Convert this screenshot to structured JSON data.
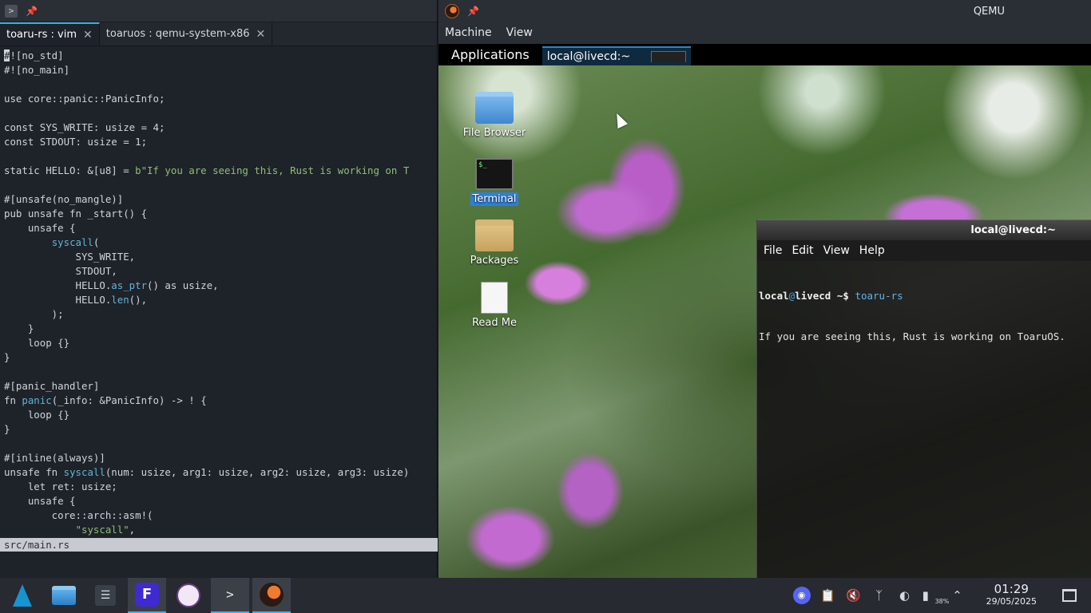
{
  "konsole": {
    "tabs": [
      {
        "label": "toaru-rs : vim",
        "active": true
      },
      {
        "label": "toaruos : qemu-system-x86",
        "active": false
      }
    ],
    "code_lines": [
      "#![no_std]",
      "#![no_main]",
      "",
      "use core::panic::PanicInfo;",
      "",
      "const SYS_WRITE: usize = 4;",
      "const STDOUT: usize = 1;",
      "",
      "static HELLO: &[u8] = b\"If you are seeing this, Rust is working on T",
      "",
      "#[unsafe(no_mangle)]",
      "pub unsafe fn _start() {",
      "    unsafe {",
      "        syscall(",
      "            SYS_WRITE,",
      "            STDOUT,",
      "            HELLO.as_ptr() as usize,",
      "            HELLO.len(),",
      "        );",
      "    }",
      "    loop {}",
      "}",
      "",
      "#[panic_handler]",
      "fn panic(_info: &PanicInfo) -> ! {",
      "    loop {}",
      "}",
      "",
      "#[inline(always)]",
      "unsafe fn syscall(num: usize, arg1: usize, arg2: usize, arg3: usize)",
      "    let ret: usize;",
      "    unsafe {",
      "        core::arch::asm!(",
      "            \"syscall\","
    ],
    "status_file": "src/main.rs"
  },
  "qemu": {
    "title": "QEMU",
    "menu": [
      "Machine",
      "View"
    ],
    "guest": {
      "panel": {
        "applications": "Applications",
        "task_label": "local@livecd:~"
      },
      "desktop_icons": [
        {
          "label": "File Browser",
          "icon": "folder-icon",
          "selected": false
        },
        {
          "label": "Terminal",
          "icon": "terminal-icon",
          "selected": true
        },
        {
          "label": "Packages",
          "icon": "package-icon",
          "selected": false
        },
        {
          "label": "Read Me",
          "icon": "document-icon",
          "selected": false
        }
      ],
      "terminal": {
        "title": "local@livecd:~",
        "menu": [
          "File",
          "Edit",
          "View",
          "Help"
        ],
        "prompt_user": "local",
        "prompt_at": "@",
        "prompt_host": "livecd",
        "prompt_path": " ~$ ",
        "command": "toaru-rs",
        "output": "If you are seeing this, Rust is working on ToaruOS."
      }
    }
  },
  "taskbar": {
    "apps": [
      "arch-launcher-icon",
      "file-manager-icon",
      "system-settings-icon",
      "fusion-icon",
      "rust-app-icon",
      "konsole-icon",
      "qemu-icon"
    ],
    "tray": {
      "battery_percent": "38%",
      "time": "01:29",
      "date": "29/05/2025"
    },
    "colors": {
      "accent": "#3daee9",
      "panel": "#272a31"
    }
  }
}
